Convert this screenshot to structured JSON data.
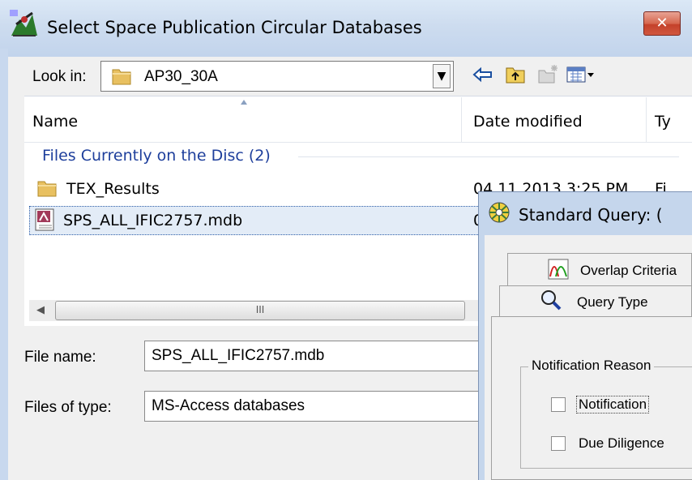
{
  "window": {
    "title": "Select Space Publication Circular Databases",
    "close_label": "✕"
  },
  "lookin": {
    "label": "Look in:",
    "value": "AP30_30A",
    "dropdown_glyph": "▼"
  },
  "toolbar": {
    "icons": [
      "back-arrow-icon",
      "up-folder-icon",
      "new-folder-icon",
      "view-menu-icon"
    ]
  },
  "file_list": {
    "columns": [
      "Name",
      "Date modified",
      "Ty"
    ],
    "group_header": "Files Currently on the Disc (2)",
    "rows": [
      {
        "name": "TEX_Results",
        "date": "04.11.2013 3:25 PM",
        "type": "Fi",
        "icon": "folder-icon"
      },
      {
        "name": "SPS_ALL_IFIC2757.mdb",
        "date": "0",
        "icon": "access-database-icon"
      }
    ],
    "scrollbar_grip": "III"
  },
  "form": {
    "filename_label": "File name:",
    "filename_value": "SPS_ALL_IFIC2757.mdb",
    "filetype_label": "Files of type:",
    "filetype_value": "MS-Access databases"
  },
  "query_window": {
    "title": "Standard Query:  (",
    "tabs": [
      {
        "label": "Overlap Criteria",
        "icon": "overlap-curves-icon"
      },
      {
        "label": "Query Type",
        "icon": "magnifier-icon"
      }
    ],
    "group_label": "Notification Reason",
    "checkboxes": [
      {
        "label": "Notification",
        "checked": false
      },
      {
        "label": "Due Diligence",
        "checked": false
      }
    ]
  },
  "colors": {
    "title_bar": "#cddcef",
    "close_button": "#c4412a",
    "group_header_text": "#1e3f9c",
    "selection": "#e3ecf7"
  }
}
